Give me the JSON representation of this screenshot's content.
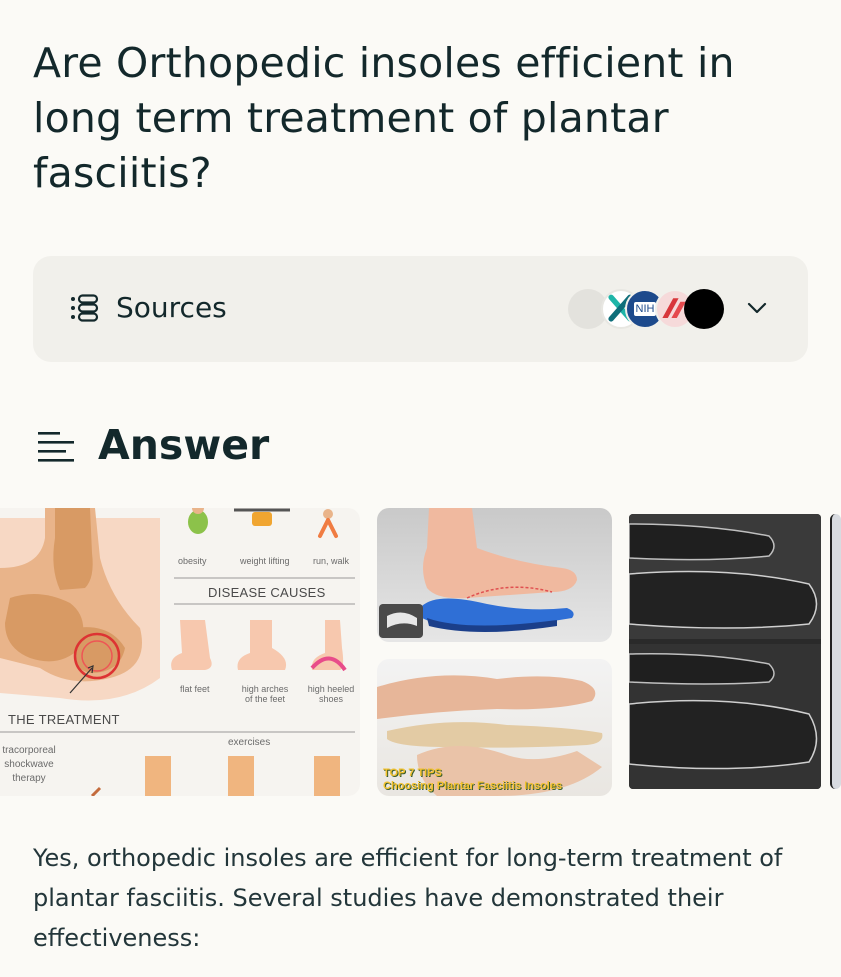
{
  "question": "Are Orthopedic insoles efficient in long term treatment of plantar fasciitis?",
  "sources": {
    "label": "Sources",
    "favicons": [
      "blank-source-icon",
      "x-source-icon",
      "nih-source-icon",
      "red-source-icon",
      "black-source-icon"
    ],
    "nih_text": "NIH"
  },
  "answer": {
    "title": "Answer",
    "images": {
      "infographic": {
        "top_labels": [
          "obesity",
          "weight lifting",
          "run, walk"
        ],
        "disease_causes": "DISEASE CAUSES",
        "feet_labels": [
          "flat feet",
          "high arches of the feet",
          "high heeled shoes"
        ],
        "treatment_heading": "THE TREATMENT",
        "exercises": "exercises",
        "therapy": "tracorporeal shockwave therapy"
      },
      "insole_tips": {
        "line1": "TOP 7 TIPS",
        "line2": "Choosing Plantar Fasciitis Insoles"
      }
    },
    "body": "Yes, orthopedic insoles are efficient for long-term treatment of plantar fasciitis. Several studies have demonstrated their effectiveness:"
  },
  "colors": {
    "text": "#13282b",
    "background": "#fbfaf6",
    "sources_bg": "#f1f0eb"
  }
}
